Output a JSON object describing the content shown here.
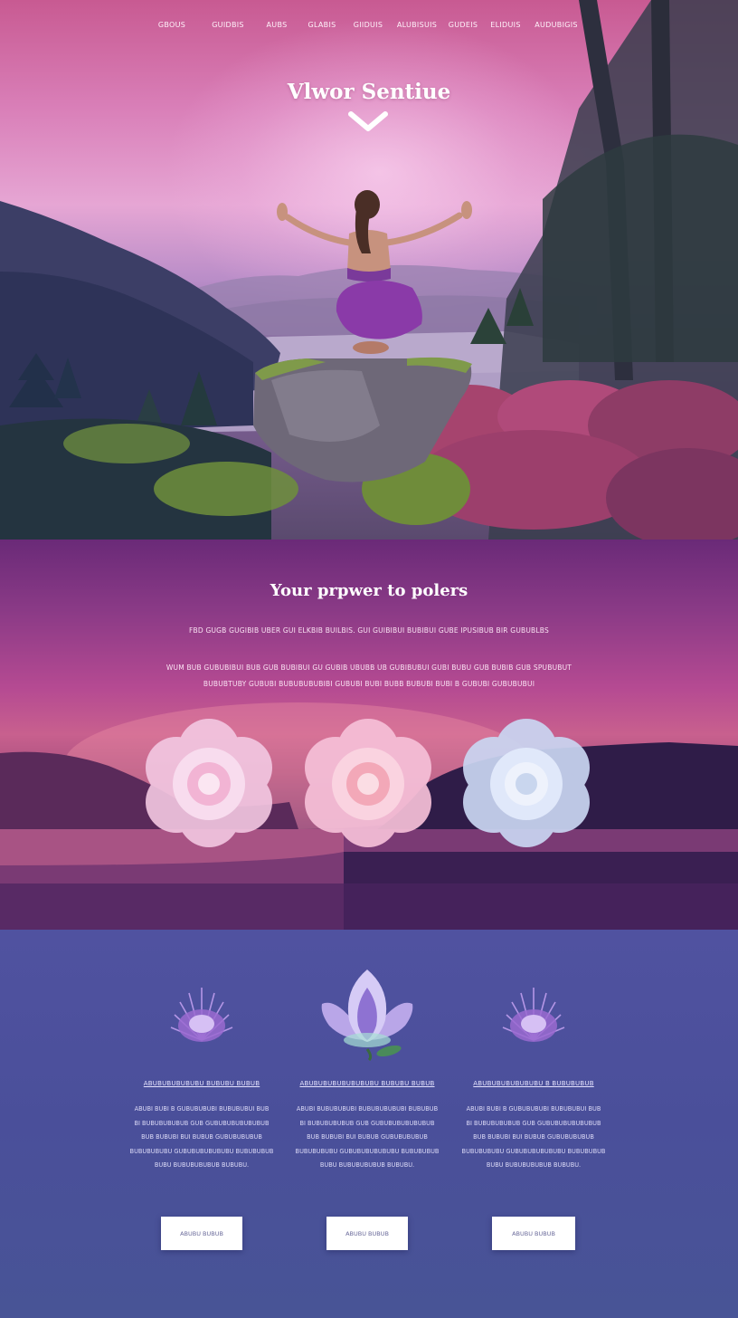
{
  "nav": {
    "items": [
      "GBOUS",
      "GUIDBIS",
      "AUBS",
      "GLABIS",
      "GIIDUIS",
      "ALUBISUIS",
      "GUDEIS",
      "ELIDUIS",
      "AUDUBIGIS"
    ]
  },
  "hero": {
    "title": "Vlwor Sentiue"
  },
  "power": {
    "heading": "Your prpwer to polers",
    "lines": [
      "FBD GUGB GUGIBIB UBER GUI ELKBIB BUILBIS. GUI GUIBIBUI BUBIBUI GUBE IPUSIBUB BIR GUBUBLBS",
      "WUM BUB GUBUBIBUI BUB GUB BUBIBUI GU GUBIB UBUBB UB GUBIBUBUI GUBI BUBU GUB BUBIB GUB SPUBUBUT",
      "BUBUBTUBY GUBUBI BUBUBUBUBIBI GUBUBI BUBI BUBB BUBUBI BUBI B GUBUBI GUBUBUBUI"
    ]
  },
  "features": {
    "columns": [
      {
        "title": "ABUBUBUBUBUBU BUBUBU BUBUB",
        "lines": [
          "ABUBI BUBI B GUBUBUBUBI BUBUBUBUI BUB",
          "BI BUBUBUBUBUB GUB GUBUBUBUBUBUBUB",
          "BUB BUBUBI BUI BUBUB GUBUBUBUBUB",
          "BUBUBUBUBU GUBUBUBUBUBUBU BUBUBUBUB",
          "BUBU BUBUBUBUBUB BUBUBU."
        ],
        "button": "ABUBU BUBUB"
      },
      {
        "title": "ABUBUBUBUBUBUBUBU BUBUBU BUBUB",
        "lines": [
          "ABUBI BUBUBUBUBI BUBUBUBUBUBI BUBUBUB",
          "BI BUBUBUBUBUB GUB GUBUBUBUBUBUBUB",
          "BUB BUBUBI BUI BUBUB GUBUBUBUBUB",
          "BUBUBUBUBU GUBUBUBUBUBUBU BUBUBUBUB",
          "BUBU BUBUBUBUBUB BUBUBU."
        ],
        "button": "ABUBU BUBUB"
      },
      {
        "title": "ABUBUBUBUBUBUBU B BUBUBUBUB",
        "lines": [
          "ABUBI BUBI B GUBUBUBUBI BUBUBUBUI BUB",
          "BI BUBUBUBUBUB GUB GUBUBUBUBUBUBUB",
          "BUB BUBUBI BUI BUBUB GUBUBUBUBUB",
          "BUBUBUBUBU GUBUBUBUBUBUBU BUBUBUBUB",
          "BUBU BUBUBUBUBUB BUBUBU."
        ],
        "button": "ABUBU BUBUB"
      }
    ]
  },
  "colors": {
    "hero_top": "#c85a92",
    "hero_glow": "#e6a6d4",
    "power_mid": "#b54a92",
    "features_bg": "#4a4f9a",
    "legging_purple": "#8a3aa8"
  }
}
